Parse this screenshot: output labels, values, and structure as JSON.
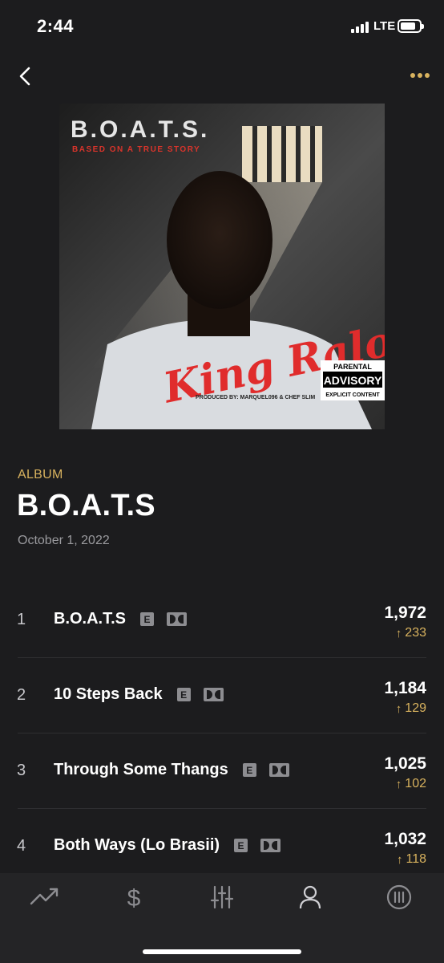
{
  "status_bar": {
    "time": "2:44",
    "network": "LTE"
  },
  "header": {
    "back_icon": "chevron-left-icon",
    "more_icon": "ellipsis-icon"
  },
  "album_art": {
    "title_text": "B.O.A.T.S.",
    "subtitle_text": "BASED ON A TRUE STORY",
    "artist_text": "King Ralo",
    "credits_text": "PRODUCED BY: MARQUEL096 & CHEF SLIM",
    "advisory_line1": "PARENTAL",
    "advisory_line2": "ADVISORY",
    "advisory_line3": "EXPLICIT CONTENT"
  },
  "album": {
    "label": "ALBUM",
    "title": "B.O.A.T.S",
    "date": "October 1, 2022"
  },
  "tracks": [
    {
      "num": "1",
      "name": "B.O.A.T.S",
      "streams": "1,972",
      "change": "233",
      "explicit": "E"
    },
    {
      "num": "2",
      "name": "10 Steps Back",
      "streams": "1,184",
      "change": "129",
      "explicit": "E"
    },
    {
      "num": "3",
      "name": "Through Some Thangs",
      "streams": "1,025",
      "change": "102",
      "explicit": "E"
    },
    {
      "num": "4",
      "name": "Both Ways (Lo Brasii)",
      "streams": "1,032",
      "change": "118",
      "explicit": "E"
    }
  ],
  "tab_bar": {
    "items": [
      {
        "icon": "trending-icon"
      },
      {
        "icon": "dollar-icon"
      },
      {
        "icon": "sliders-icon"
      },
      {
        "icon": "user-icon"
      },
      {
        "icon": "pause-circle-icon"
      }
    ]
  },
  "colors": {
    "accent": "#d8b25e",
    "background": "#1c1c1e",
    "tab_bar": "#242426"
  }
}
